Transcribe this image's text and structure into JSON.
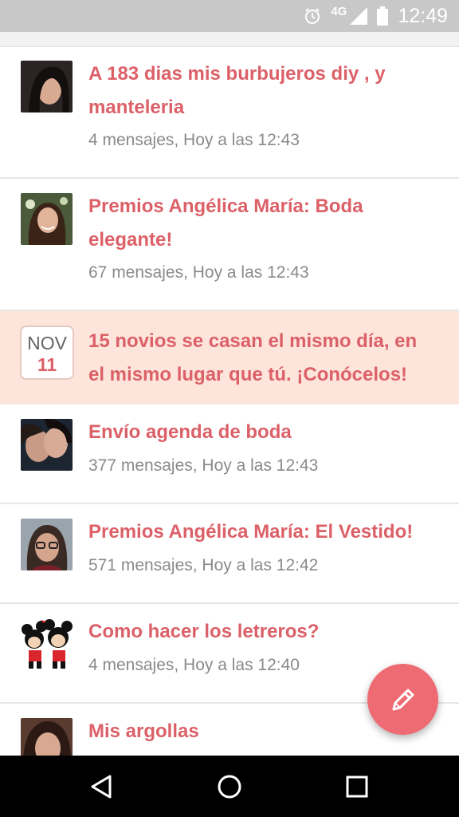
{
  "status_bar": {
    "network": "4G",
    "time": "12:49",
    "icons": [
      "alarm-icon",
      "signal-icon",
      "battery-icon"
    ]
  },
  "threads": [
    {
      "title": "A 183 dias mis burbujeros diy , y manteleria",
      "meta": "4 mensajes, Hoy a las 12:43",
      "avatar": "avatar-woman-dark-hair"
    },
    {
      "title": "Premios Angélica María: Boda elegante!",
      "meta": "67 mensajes, Hoy a las 12:43",
      "avatar": "avatar-woman-smiling"
    },
    {
      "title": "Envío agenda de boda",
      "meta": "377 mensajes, Hoy a las 12:43",
      "avatar": "avatar-couple-kissing"
    },
    {
      "title": "Premios Angélica María: El Vestido!",
      "meta": "571 mensajes, Hoy a las 12:42",
      "avatar": "avatar-woman-glasses"
    },
    {
      "title": "Como hacer los letreros?",
      "meta": "4 mensajes, Hoy a las 12:40",
      "avatar": "avatar-mickey-minnie"
    },
    {
      "title": "Mis argollas",
      "meta": "",
      "avatar": "avatar-woman-selfie"
    }
  ],
  "promo": {
    "month": "NOV",
    "day": "11",
    "title": "15 novios se casan el mismo día, en el mismo lugar que tú. ¡Conócelos!"
  },
  "fab": {
    "icon": "pencil-icon"
  },
  "nav_bar": {
    "icons": [
      "back-icon",
      "home-icon",
      "recents-icon"
    ]
  },
  "colors": {
    "accent": "#dc6068",
    "fab": "#ee6b73",
    "promo_bg": "#fde5dc",
    "meta_text": "#8a8a8a"
  }
}
